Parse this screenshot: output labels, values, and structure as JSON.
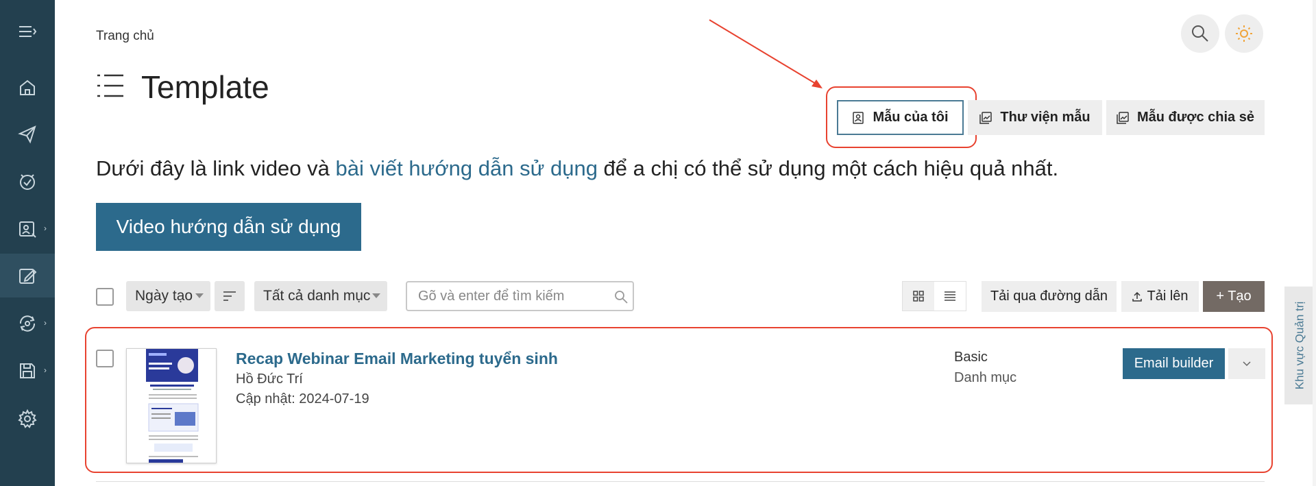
{
  "header": {
    "breadcrumb": "Trang chủ",
    "page_title": "Template"
  },
  "tabs": [
    {
      "label": "Mẫu của tôi",
      "selected": true,
      "icon": "user-portrait-icon"
    },
    {
      "label": "Thư viện mẫu",
      "selected": false,
      "icon": "gallery-icon"
    },
    {
      "label": "Mẫu được chia sẻ",
      "selected": false,
      "icon": "gallery-icon"
    }
  ],
  "intro": {
    "before": "Dưới đây là link video và ",
    "link": "bài viết hướng dẫn sử dụng",
    "after": " để a chị có thể sử dụng một cách hiệu quả nhất."
  },
  "video_button": "Video hướng dẫn sử dụng",
  "toolbar": {
    "sort_select": "Ngày tạo",
    "category_select": "Tất cả danh mục",
    "search_placeholder": "Gõ và enter để tìm kiếm",
    "import_url": "Tải qua đường dẫn",
    "upload": "Tải lên",
    "create": "+ Tạo"
  },
  "templates": [
    {
      "title": "Recap Webinar Email Marketing tuyển sinh",
      "author": "Hồ Đức Trí",
      "updated": "Cập nhật: 2024-07-19",
      "type": "Basic",
      "category": "Danh mục",
      "action": "Email builder"
    }
  ],
  "side_tab": "Khu vực Quản trị",
  "colors": {
    "sidebar": "#23404f",
    "primary": "#2c6a8c",
    "highlight": "#e8422f",
    "create_button": "#736a64"
  },
  "sidebar_icons": [
    "menu-expand-icon",
    "home-icon",
    "send-icon",
    "badge-check-icon",
    "report-icon",
    "edit-template-icon",
    "automation-icon",
    "save-icon",
    "settings-icon"
  ]
}
